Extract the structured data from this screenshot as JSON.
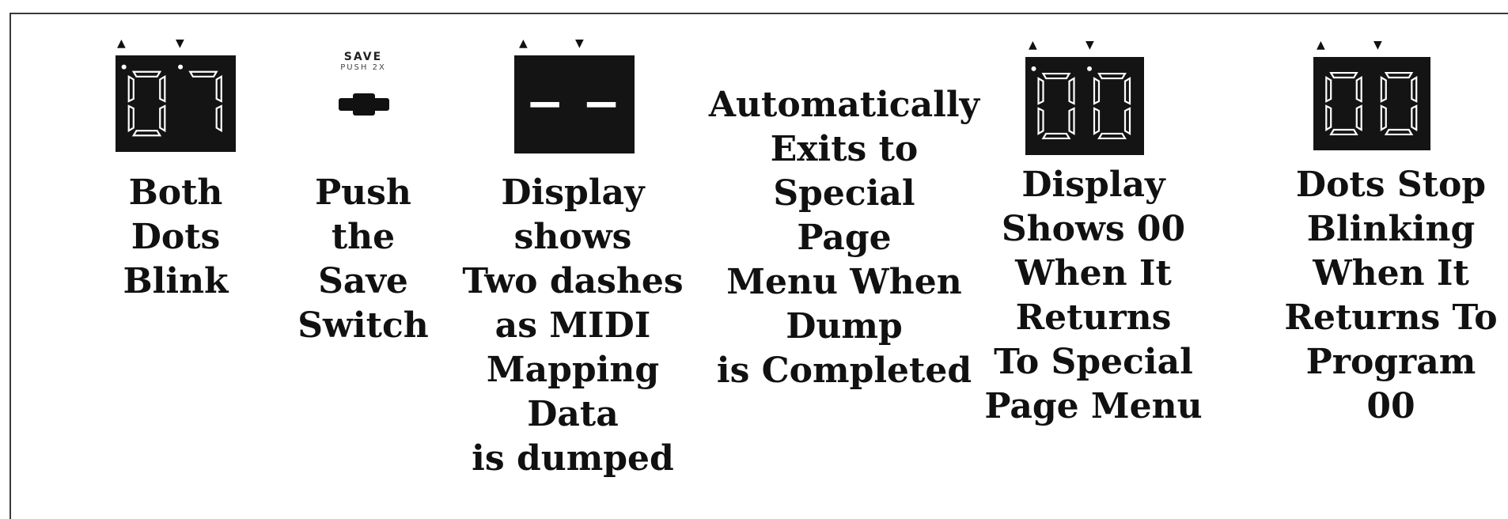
{
  "steps": [
    {
      "id": "both-dots-blink",
      "display": {
        "digits": "07",
        "left_dot": true,
        "right_dot": true,
        "dots_blinking": true
      },
      "caption": [
        "Both",
        "Dots",
        "Blink"
      ]
    },
    {
      "id": "push-save",
      "switch": {
        "title": "SAVE",
        "subtitle": "PUSH 2X"
      },
      "caption": [
        "Push",
        "the",
        "Save",
        "Switch"
      ]
    },
    {
      "id": "dashes",
      "display": {
        "digits": "--",
        "left_dot": false,
        "right_dot": false,
        "dots_blinking": false
      },
      "caption": [
        "Display",
        "shows",
        "Two dashes",
        "as MIDI",
        "Mapping",
        "Data",
        "is dumped"
      ]
    },
    {
      "id": "auto-exit",
      "caption": [
        "Automatically",
        "Exits to",
        "Special",
        "Page",
        "Menu When",
        "Dump",
        "is Completed"
      ]
    },
    {
      "id": "shows-00",
      "display": {
        "digits": "00",
        "left_dot": true,
        "right_dot": true,
        "dots_blinking": false
      },
      "caption": [
        "Display",
        "Shows 00",
        "When It",
        "Returns",
        "To Special",
        "Page Menu"
      ]
    },
    {
      "id": "dots-stop",
      "display": {
        "digits": "00",
        "left_dot": false,
        "right_dot": false,
        "dots_blinking": false
      },
      "caption": [
        "Dots Stop",
        "Blinking",
        "When  It",
        "Returns To",
        "Program",
        "00"
      ]
    }
  ],
  "colors": {
    "display_bg": "#141414",
    "segment": "#ffffff",
    "text": "#111111",
    "border": "#3a3a3a"
  }
}
